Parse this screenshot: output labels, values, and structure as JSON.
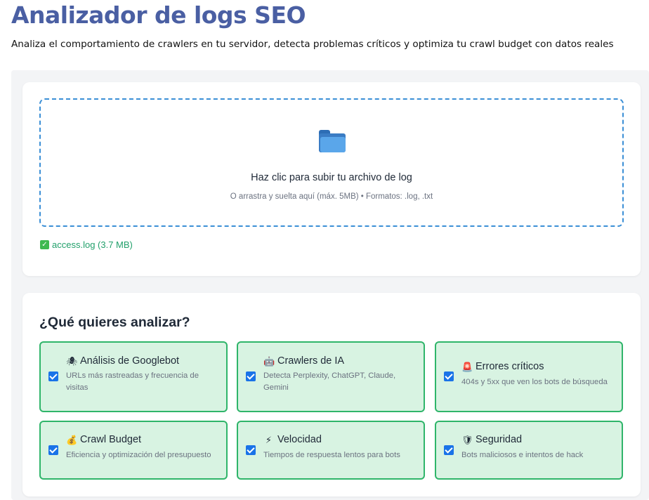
{
  "header": {
    "title": "Analizador de logs SEO",
    "subtitle": "Analiza el comportamiento de crawlers en tu servidor, detecta problemas críticos y optimiza tu crawl budget con datos reales"
  },
  "upload": {
    "icon": "folder-icon",
    "title": "Haz clic para subir tu archivo de log",
    "hint": "O arrastra y suelta aquí (máx. 5MB) • Formatos: .log, .txt",
    "file_status": "access.log (3.7 MB)",
    "status_icon": "✓"
  },
  "options": {
    "title": "¿Qué quieres analizar?",
    "items": [
      {
        "emoji": "🕷",
        "label": "Análisis de Googlebot",
        "desc": "URLs más rastreadas y frecuencia de visitas",
        "checked": true
      },
      {
        "emoji": "🤖",
        "label": "Crawlers de IA",
        "desc": "Detecta Perplexity, ChatGPT, Claude, Gemini",
        "checked": true
      },
      {
        "emoji": "🚨",
        "label": "Errores críticos",
        "desc": "404s y 5xx que ven los bots de búsqueda",
        "checked": true
      },
      {
        "emoji": "💰",
        "label": "Crawl Budget",
        "desc": "Eficiencia y optimización del presupuesto",
        "checked": true
      },
      {
        "emoji": "⚡",
        "label": "Velocidad",
        "desc": "Tiempos de respuesta lentos para bots",
        "checked": true
      },
      {
        "emoji": "🛡",
        "label": "Seguridad",
        "desc": "Bots maliciosos e intentos de hack",
        "checked": true
      }
    ]
  },
  "colors": {
    "title": "#4a5fa3",
    "accent": "#1a73e8",
    "option_bg": "#d8f3e2",
    "option_border": "#2fb56a",
    "success": "#22a06b"
  }
}
